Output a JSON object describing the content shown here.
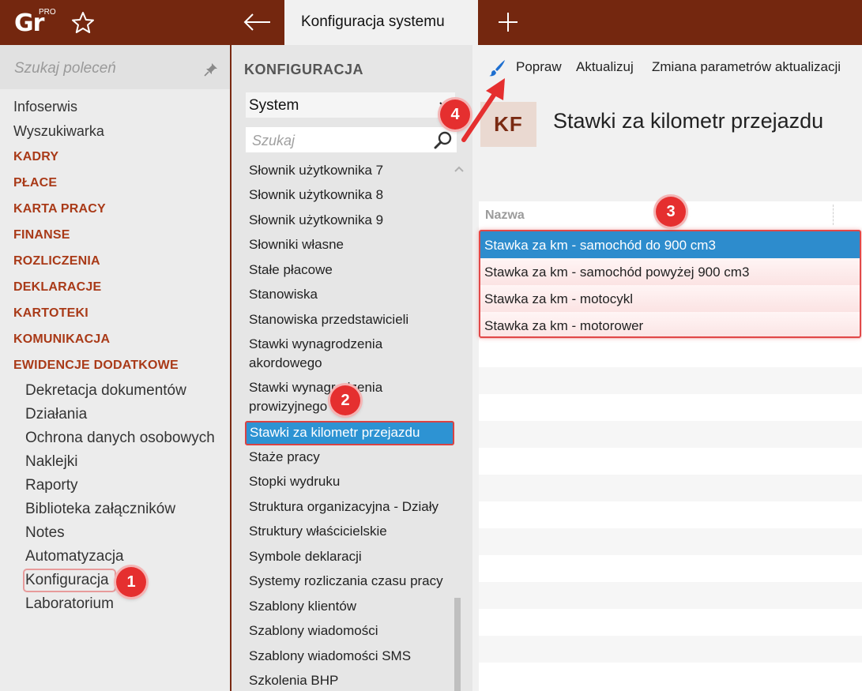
{
  "topbar": {
    "logo_text": "Gr",
    "logo_badge": "PRO",
    "tab_title": "Konfiguracja systemu"
  },
  "leftnav": {
    "search_placeholder": "Szukaj poleceń",
    "top_items": [
      "Infoserwis",
      "Wyszukiwarka"
    ],
    "sections": [
      "KADRY",
      "PŁACE",
      "KARTA PRACY",
      "FINANSE",
      "ROZLICZENIA",
      "DEKLARACJE",
      "KARTOTEKI",
      "KOMUNIKACJA",
      "EWIDENCJE DODATKOWE"
    ],
    "sub_items": [
      "Dekretacja dokumentów",
      "Działania",
      "Ochrona danych osobowych",
      "Naklejki",
      "Raporty",
      "Biblioteka załączników",
      "Notes",
      "Automatyzacja",
      "Konfiguracja",
      "Laboratorium"
    ]
  },
  "middle": {
    "title": "KONFIGURACJA",
    "select_value": "System",
    "search_placeholder": "Szukaj",
    "items": [
      "Słownik użytkownika 7",
      "Słownik użytkownika 8",
      "Słownik użytkownika 9",
      "Słowniki własne",
      "Stałe płacowe",
      "Stanowiska",
      "Stanowiska przedstawicieli",
      "Stawki wynagrodzenia akordowego",
      "Stawki wynagrodzenia prowizyjnego",
      "Stawki za kilometr przejazdu",
      "Staże pracy",
      "Stopki wydruku",
      "Struktura organizacyjna - Działy",
      "Struktury właścicielskie",
      "Symbole deklaracji",
      "Systemy rozliczania czasu pracy",
      "Szablony klientów",
      "Szablony wiadomości",
      "Szablony wiadomości SMS",
      "Szkolenia BHP"
    ]
  },
  "toolbar": {
    "fix_label": "Popraw",
    "update_label": "Aktualizuj",
    "params_label": "Zmiana parametrów aktualizacji"
  },
  "main": {
    "badge": "KF",
    "title": "Stawki za kilometr przejazdu",
    "column_header": "Nazwa",
    "rows": [
      "Stawka za km - samochód do 900 cm3",
      "Stawka za km - samochód powyżej 900 cm3",
      "Stawka za km - motocykl",
      "Stawka za km - motorower"
    ]
  },
  "annotations": {
    "step1": "1",
    "step2": "2",
    "step3": "3",
    "step4": "4"
  },
  "colors": {
    "topbar": "#74270f",
    "section_text": "#a93a18",
    "selection": "#2d8ccd",
    "annotation": "#e52f2f"
  }
}
